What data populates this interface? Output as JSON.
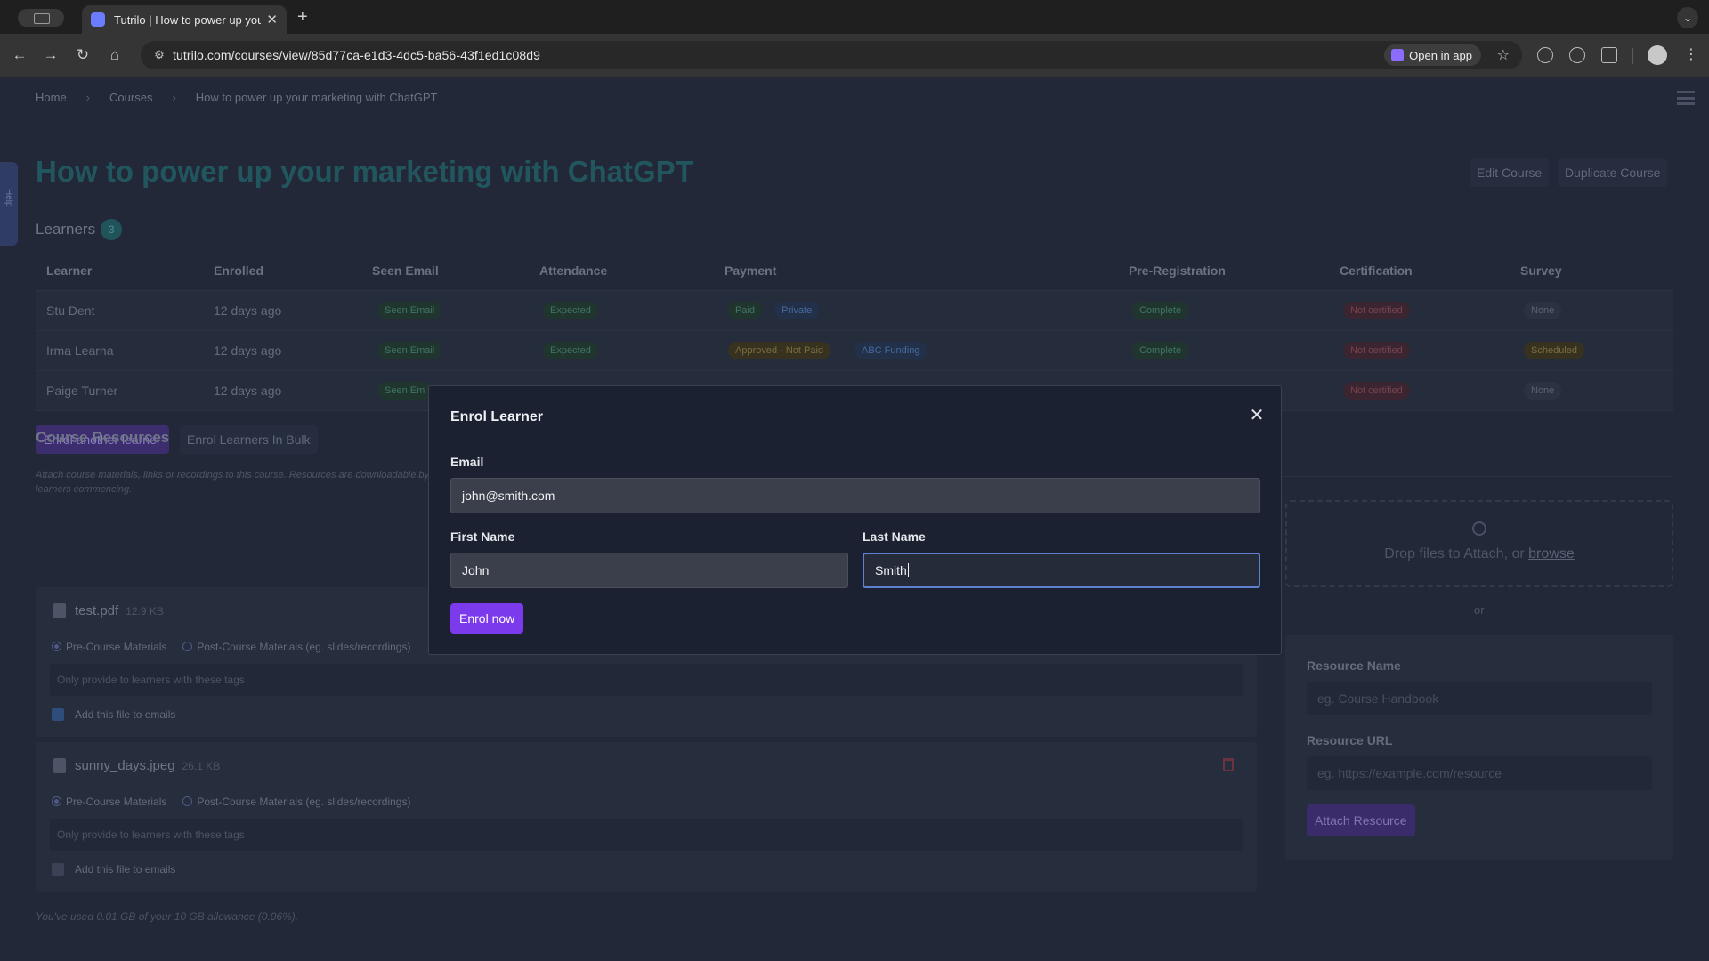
{
  "browser": {
    "tab_title": "Tutrilo | How to power up your marketing with ChatGPT",
    "url": "tutrilo.com/courses/view/85d77ca-e1d3-4dc5-ba56-43f1ed1c08d9",
    "open_in_app": "Open in app"
  },
  "page": {
    "breadcrumb": [
      "Home",
      "Courses",
      "How to power up your marketing with ChatGPT"
    ],
    "side_tab": "Help",
    "title": "How to power up your marketing with ChatGPT",
    "edit_course": "Edit Course",
    "duplicate_course": "Duplicate Course",
    "learners_label": "Learners",
    "learners_count": "3",
    "table": {
      "headers": [
        "Learner",
        "Enrolled",
        "Seen Email",
        "Attendance",
        "Payment",
        "Pre-Registration",
        "Certification",
        "Survey"
      ],
      "rows": [
        {
          "learner": "Stu Dent",
          "enrolled": "12 days ago",
          "seen": "Seen Email",
          "attendance": "Expected",
          "pay1": "Paid",
          "pay2": "Private",
          "prereg": "Complete",
          "cert": "Not certified",
          "survey": "None"
        },
        {
          "learner": "Irma Learna",
          "enrolled": "12 days ago",
          "seen": "Seen Email",
          "attendance": "Expected",
          "pay1": "Approved - Not Paid",
          "pay2": "ABC Funding",
          "prereg": "Complete",
          "cert": "Not certified",
          "survey": "Scheduled"
        },
        {
          "learner": "Paige Turner",
          "enrolled": "12 days ago",
          "seen": "Seen Em",
          "cert": "Not certified",
          "survey": "None"
        }
      ]
    },
    "enrol_another": "Enrol another learner",
    "enrol_bulk": "Enrol Learners In Bulk",
    "resources_title": "Course Resources",
    "resources_desc": "Attach course materials, links or recordings to this course. Resources are downloadable by learners commencing.",
    "files": [
      {
        "name": "test.pdf",
        "size": "12.9 KB",
        "pre": "Pre-Course Materials",
        "post": "Post-Course Materials (eg. slides/recordings)",
        "tags_placeholder": "Only provide to learners with these tags",
        "email_label": "Add this file to emails"
      },
      {
        "name": "sunny_days.jpeg",
        "size": "26.1 KB",
        "pre": "Pre-Course Materials",
        "post": "Post-Course Materials (eg. slides/recordings)",
        "tags_placeholder": "Only provide to learners with these tags",
        "email_label": "Add this file to emails"
      }
    ],
    "usage_note": "You've used 0.01 GB of your 10 GB allowance (0.06%).",
    "drop_text": "Drop files to Attach, or",
    "browse": "browse",
    "or": "or",
    "resource_name_label": "Resource Name",
    "resource_name_placeholder": "eg. Course Handbook",
    "resource_url_label": "Resource URL",
    "resource_url_placeholder": "eg. https://example.com/resource",
    "attach_resource": "Attach Resource"
  },
  "modal": {
    "title": "Enrol Learner",
    "email_label": "Email",
    "email_value": "john@smith.com",
    "first_name_label": "First Name",
    "first_name_value": "John",
    "last_name_label": "Last Name",
    "last_name_value": "Smith",
    "submit": "Enrol now"
  }
}
